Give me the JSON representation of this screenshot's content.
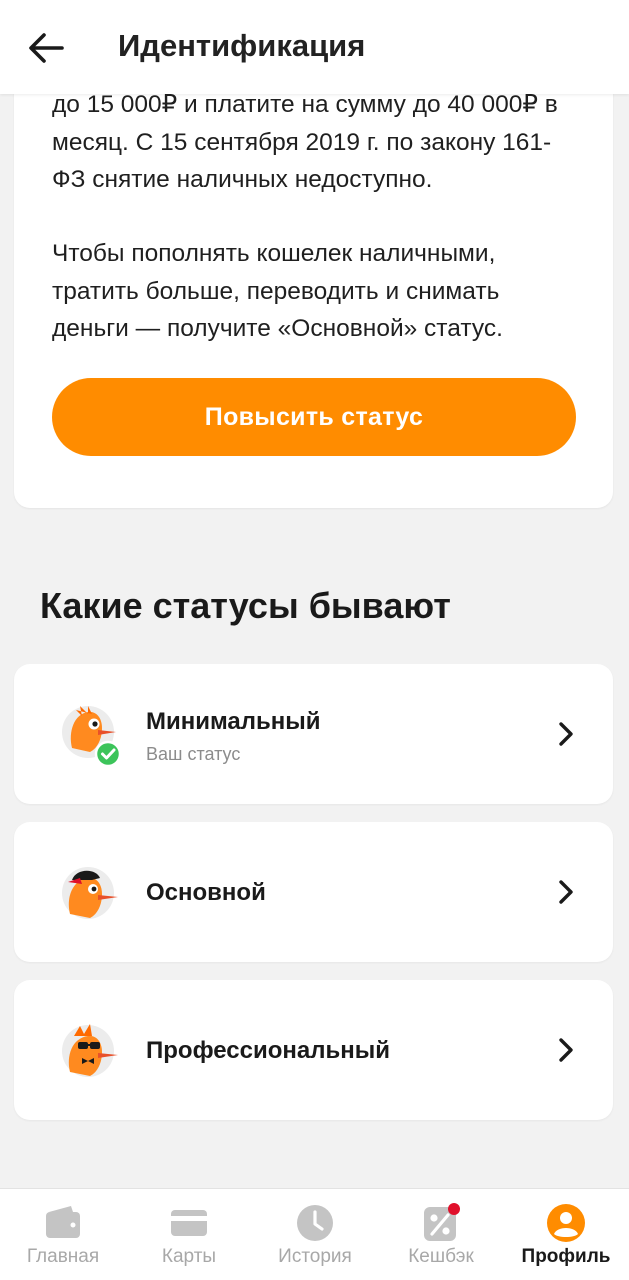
{
  "header": {
    "title": "Идентификация"
  },
  "info": {
    "paragraph1": "до 15 000₽ и платите на сумму до 40 000₽ в месяц. С 15 сентября 2019 г. по закону 161-ФЗ снятие наличных недоступно.",
    "paragraph2": "Чтобы пополнять кошелек наличными, тратить больше, переводить и снимать деньги  — получите «Основной» статус.",
    "cta_label": "Повысить статус"
  },
  "section": {
    "title": "Какие статусы бывают"
  },
  "statuses": [
    {
      "name": "Минимальный",
      "subtitle": "Ваш статус",
      "icon": "bird-minimal-icon",
      "current": true
    },
    {
      "name": "Основной",
      "subtitle": "",
      "icon": "bird-cap-icon",
      "current": false
    },
    {
      "name": "Профессиональный",
      "subtitle": "",
      "icon": "bird-sunglasses-icon",
      "current": false
    }
  ],
  "nav": {
    "items": [
      {
        "label": "Главная",
        "icon": "wallet-icon",
        "active": false
      },
      {
        "label": "Карты",
        "icon": "card-icon",
        "active": false
      },
      {
        "label": "История",
        "icon": "clock-icon",
        "active": false
      },
      {
        "label": "Кешбэк",
        "icon": "percent-icon",
        "active": false,
        "badge": true
      },
      {
        "label": "Профиль",
        "icon": "profile-icon",
        "active": true
      }
    ]
  },
  "colors": {
    "accent": "#ff8c00",
    "check": "#3cc45a",
    "badge": "#e0102b",
    "nav_inactive": "#c4c4c4"
  }
}
